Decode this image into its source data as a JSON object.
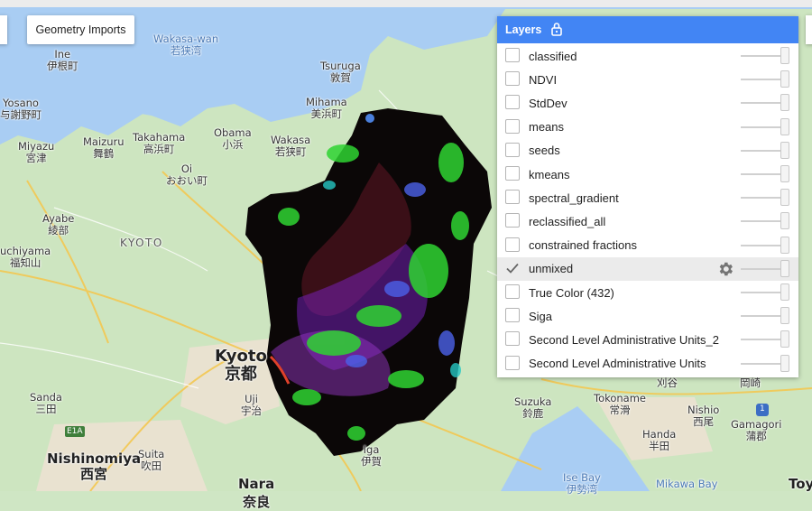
{
  "toolbar": {
    "geometry_imports_label": "Geometry Imports"
  },
  "layers_panel": {
    "title": "Layers",
    "lock_icon": "lock-icon",
    "items": [
      {
        "label": "classified",
        "checked": false
      },
      {
        "label": "NDVI",
        "checked": false
      },
      {
        "label": "StdDev",
        "checked": false
      },
      {
        "label": "means",
        "checked": false
      },
      {
        "label": "seeds",
        "checked": false
      },
      {
        "label": "kmeans",
        "checked": false
      },
      {
        "label": "spectral_gradient",
        "checked": false
      },
      {
        "label": "reclassified_all",
        "checked": false
      },
      {
        "label": "constrained fractions",
        "checked": false
      },
      {
        "label": "unmixed",
        "checked": true,
        "highlighted": true,
        "settings_icon": "gear-icon"
      },
      {
        "label": "True Color (432)",
        "checked": false
      },
      {
        "label": "Siga",
        "checked": false
      },
      {
        "label": "Second Level Administrative Units_2",
        "checked": false
      },
      {
        "label": "Second Level Administrative Units",
        "checked": false
      }
    ]
  },
  "map": {
    "labels": {
      "wakasa_wan": "Wakasa-wan",
      "wakasa_wan_jp": "若狭湾",
      "ine": "Ine",
      "ine_jp": "伊根町",
      "yosano": "Yosano",
      "yosano_jp": "与謝野町",
      "tsuruga": "Tsuruga",
      "tsuruga_jp": "敦賀",
      "mihama": "Mihama",
      "mihama_jp": "美浜町",
      "miyazu": "Miyazu",
      "miyazu_jp": "宮津",
      "maizuru": "Maizuru",
      "maizuru_jp": "舞鶴",
      "takahama": "Takahama",
      "takahama_jp": "高浜町",
      "obama": "Obama",
      "obama_jp": "小浜",
      "wakasa": "Wakasa",
      "wakasa_jp": "若狭町",
      "oi": "Oi",
      "oi_jp": "おおい町",
      "ayabe": "Ayabe",
      "ayabe_jp": "綾部",
      "kyoto_region": "KYOTO",
      "fukuchiyama": "uchiyama",
      "fukuchiyama_jp": "福知山",
      "kyoto": "Kyoto",
      "kyoto_jp": "京都",
      "sanda": "Sanda",
      "sanda_jp": "三田",
      "uji": "Uji",
      "uji_jp": "宇治",
      "suita": "Suita",
      "suita_jp": "吹田",
      "nishinomiya": "Nishinomiya",
      "nishinomiya_jp": "西宮",
      "nara": "Nara",
      "nara_jp": "奈良",
      "iga": "Iga",
      "iga_jp": "伊賀",
      "suzuka": "Suzuka",
      "suzuka_jp": "鈴鹿",
      "tokoname": "Tokoname",
      "tokoname_jp": "常滑",
      "handa": "Handa",
      "handa_jp": "半田",
      "nishio": "Nishio",
      "nishio_jp": "西尾",
      "kariya_jp": "刈谷",
      "okazaki_jp": "岡崎",
      "gamagori": "Gamagori",
      "gamagori_jp": "蒲郡",
      "ise_bay": "Ise Bay",
      "ise_bay_jp": "伊勢湾",
      "mikawa_bay": "Mikawa Bay",
      "toy": "Toy",
      "route_e1a": "E1A",
      "route_1": "1"
    }
  }
}
